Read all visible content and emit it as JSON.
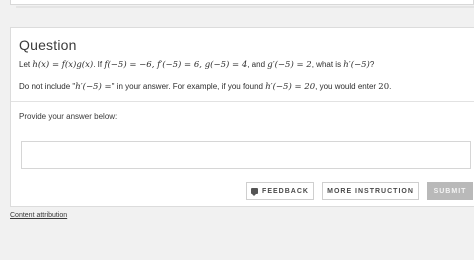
{
  "question": {
    "title": "Question",
    "prompt_text": {
      "p1": "Let ",
      "m1": "h(x) = f(x)g(x)",
      "p2": ". If ",
      "m2": "f(−5) = −6, f′(−5) = 6, g(−5) = 4",
      "p3": ", and ",
      "m3": "g′(−5) = 2",
      "p4": ", what is ",
      "m4": "h′(−5)",
      "p5": "?"
    },
    "hint": {
      "p1": "Do not include \"",
      "m1": "h′(−5) =",
      "p2": "\" in your answer. For example, if you found ",
      "m2": "h′(−5) = 20",
      "p3": ", you would enter ",
      "m3": "20",
      "p4": "."
    }
  },
  "answer": {
    "label": "Provide your answer below:",
    "value": ""
  },
  "buttons": {
    "feedback": "FEEDBACK",
    "more_instruction": "MORE INSTRUCTION",
    "submit": "SUBMIT"
  },
  "footer": {
    "attribution": "Content attribution"
  },
  "colors": {
    "submit_bg": "#b9b9b9",
    "page_bg": "#f1f1f1"
  }
}
